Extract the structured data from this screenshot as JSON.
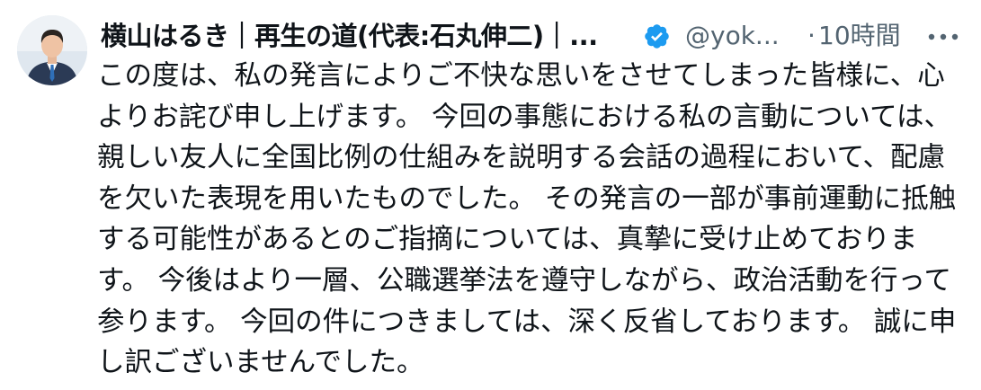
{
  "author": {
    "display_name": "横山はるき｜再生の道(代表:石丸伸二)｜...",
    "handle": "@yok...",
    "verified": true,
    "avatar_icon": "person-avatar"
  },
  "meta": {
    "separator": "·",
    "time": "10時間"
  },
  "icons": {
    "verified": "verified-badge-icon",
    "more": "more-options-icon"
  },
  "colors": {
    "verified_blue": "#1d9bf0",
    "text_primary": "#0f1419",
    "text_secondary": "#536471"
  },
  "tweet": {
    "text": "この度は、私の発言によりご不快な思いをさせてしまった皆様に、心よりお詫び申し上げます。 今回の事態における私の言動については、親しい友人に全国比例の仕組みを説明する会話の過程において、配慮を欠いた表現を用いたものでした。 その発言の一部が事前運動に抵触する可能性があるとのご指摘については、真摯に受け止めております。 今後はより一層、公職選挙法を遵守しながら、政治活動を行って参ります。 今回の件につきましては、深く反省しております。 誠に申し訳ございませんでした。"
  }
}
